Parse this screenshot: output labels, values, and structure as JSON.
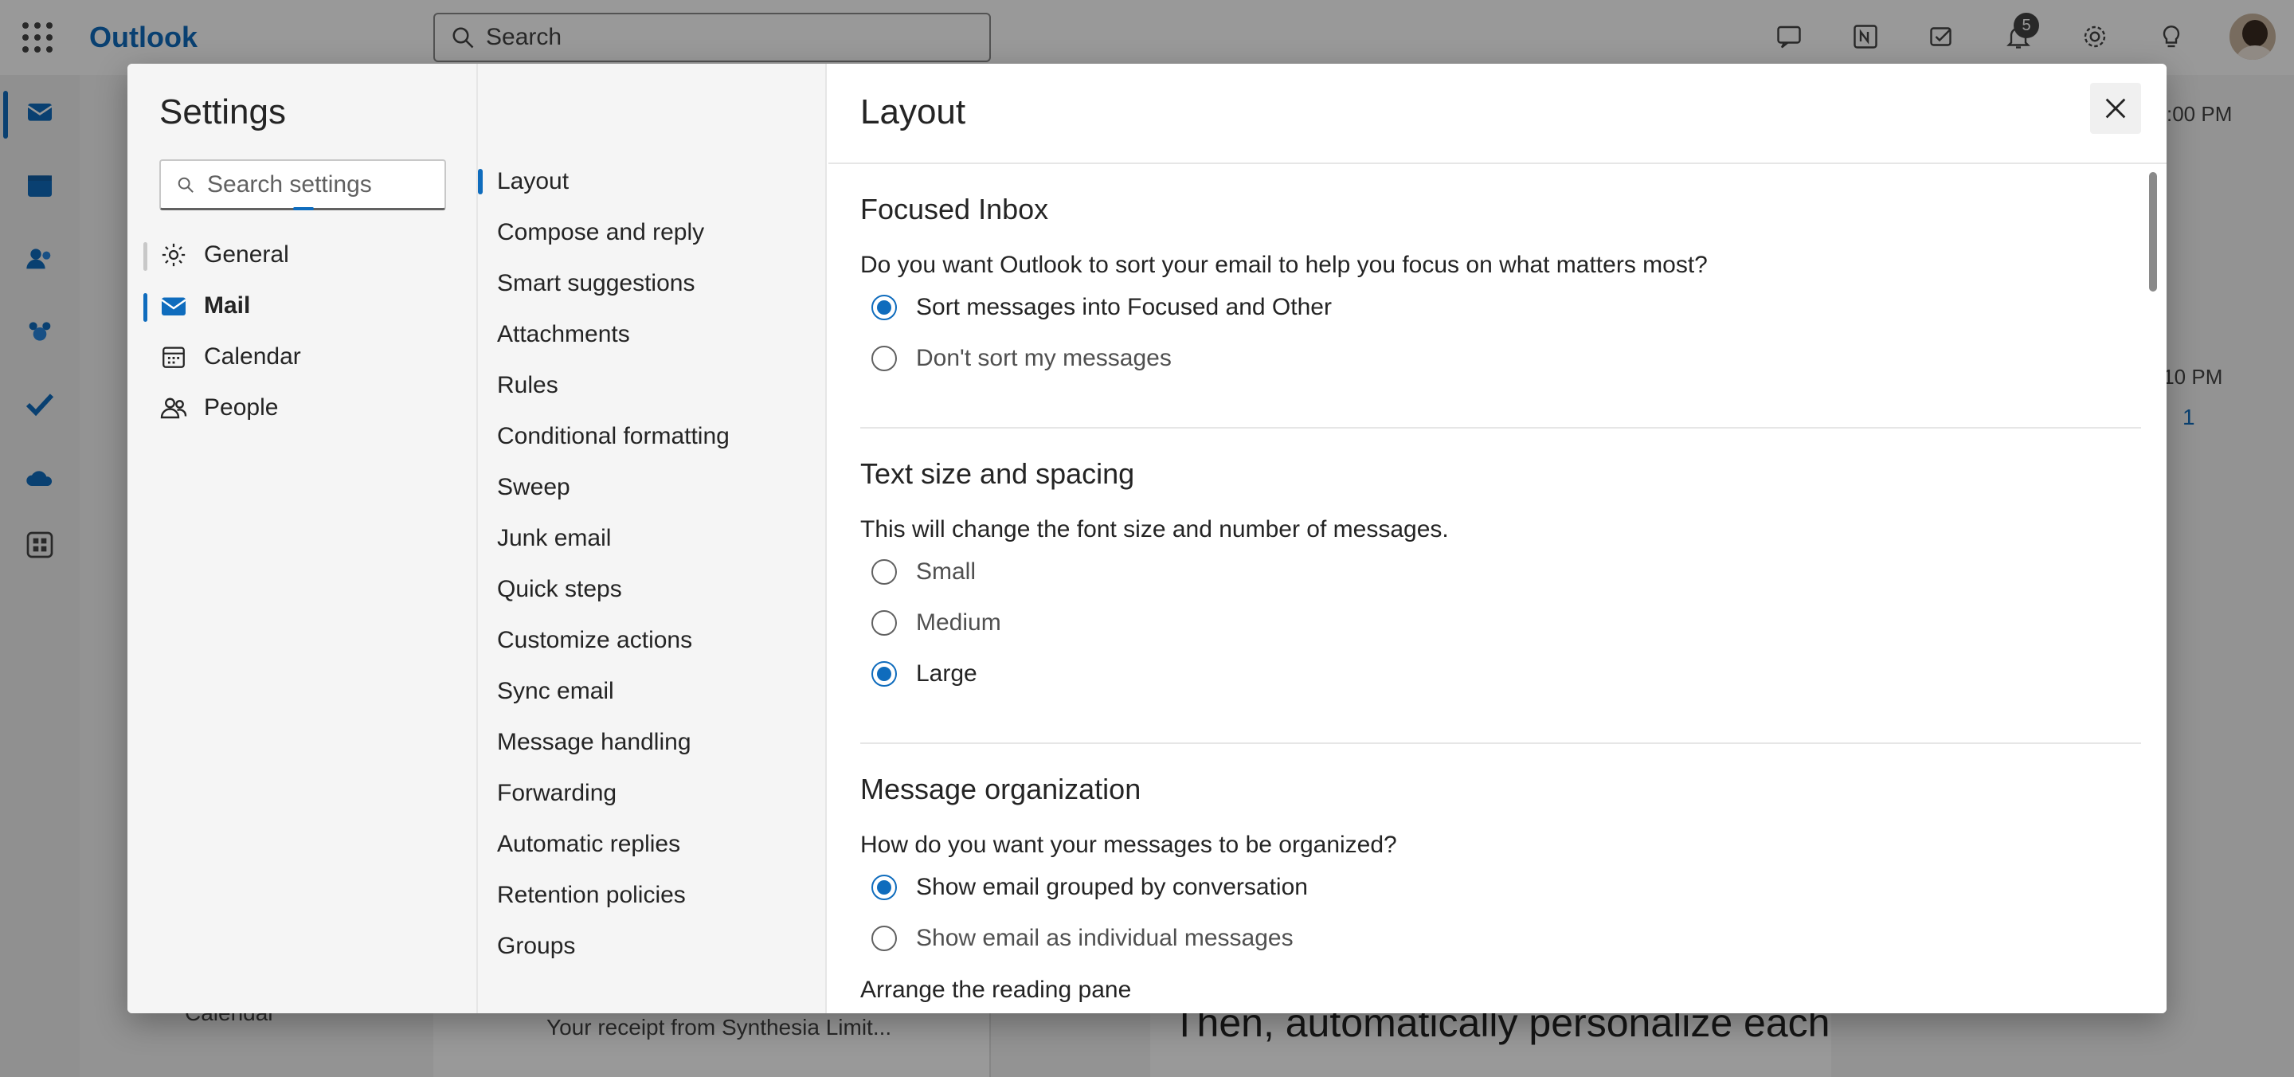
{
  "app": {
    "brand": "Outlook",
    "search_placeholder": "Search",
    "notification_count": "5"
  },
  "background": {
    "time_1": ":00 PM",
    "time_2": ":10 PM",
    "like_count": "1",
    "receipt_preview": "Your receipt from Synthesia Limit...",
    "calendar_label": "Calendar",
    "promo_text": "Then, automatically personalize each"
  },
  "settings": {
    "title": "Settings",
    "search_placeholder": "Search settings",
    "categories": [
      {
        "label": "General",
        "icon": "gear-icon"
      },
      {
        "label": "Mail",
        "icon": "mail-icon"
      },
      {
        "label": "Calendar",
        "icon": "calendar-icon"
      },
      {
        "label": "People",
        "icon": "people-icon"
      }
    ],
    "selected_category": "Mail",
    "subcategories": [
      "Layout",
      "Compose and reply",
      "Smart suggestions",
      "Attachments",
      "Rules",
      "Conditional formatting",
      "Sweep",
      "Junk email",
      "Quick steps",
      "Customize actions",
      "Sync email",
      "Message handling",
      "Forwarding",
      "Automatic replies",
      "Retention policies",
      "Groups"
    ],
    "selected_subcategory": "Layout"
  },
  "layout_panel": {
    "title": "Layout",
    "focused_inbox": {
      "heading": "Focused Inbox",
      "question": "Do you want Outlook to sort your email to help you focus on what matters most?",
      "options": [
        "Sort messages into Focused and Other",
        "Don't sort my messages"
      ],
      "selected": "Sort messages into Focused and Other"
    },
    "text_size": {
      "heading": "Text size and spacing",
      "question": "This will change the font size and number of messages.",
      "options": [
        "Small",
        "Medium",
        "Large"
      ],
      "selected": "Large"
    },
    "message_org": {
      "heading": "Message organization",
      "question": "How do you want your messages to be organized?",
      "options": [
        "Show email grouped by conversation",
        "Show email as individual messages"
      ],
      "selected": "Show email grouped by conversation"
    },
    "reading_pane": {
      "heading": "Arrange the reading pane"
    }
  },
  "colors": {
    "accent": "#0f6cbd",
    "overlay": "rgba(0,0,0,0.40)"
  }
}
